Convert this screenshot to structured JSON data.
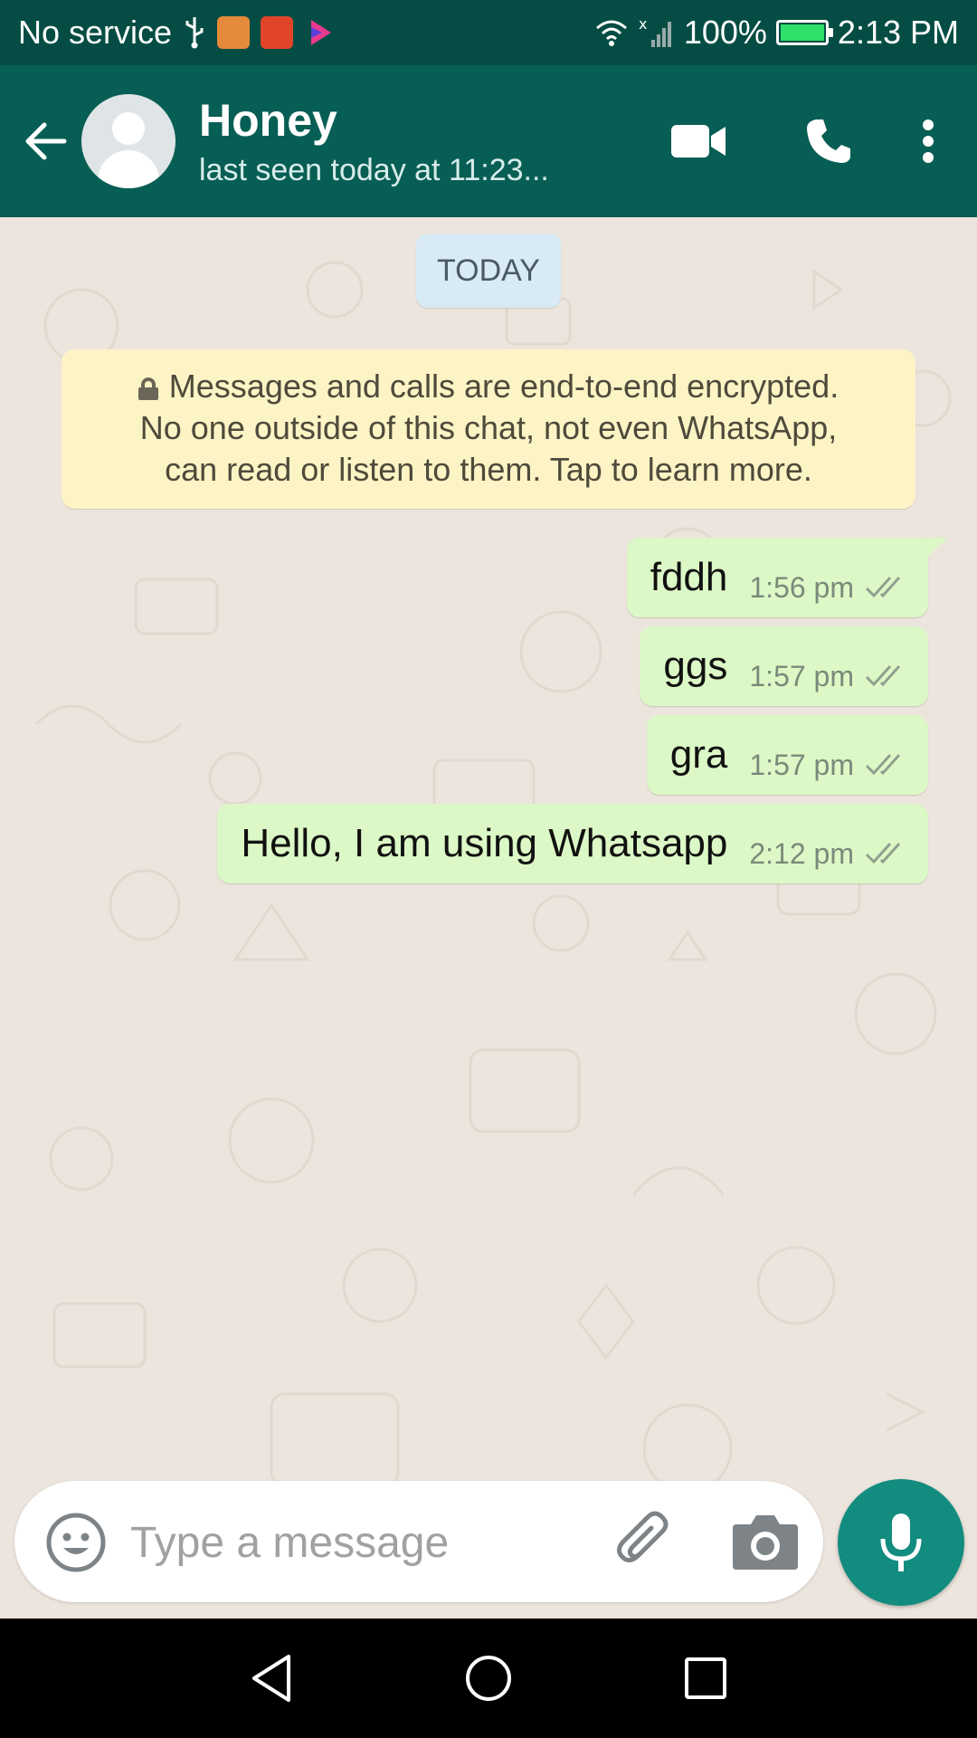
{
  "status_bar": {
    "carrier": "No service",
    "battery": "100%",
    "battery_level": 1.0,
    "time": "2:13 PM"
  },
  "header": {
    "contact_name": "Honey",
    "contact_status": "last seen today at 11:23...",
    "icons": [
      "back-arrow-icon",
      "avatar",
      "video-call-icon",
      "phone-icon",
      "more-options-icon"
    ]
  },
  "chat": {
    "date_label": "TODAY",
    "encryption_notice": {
      "line1": "Messages and calls are end-to-end encrypted.",
      "line2": "No one outside of this chat, not even WhatsApp,",
      "line3": "can read or listen to them. Tap to learn more."
    },
    "messages": [
      {
        "text": "fddh",
        "time": "1:56 pm",
        "status": "read"
      },
      {
        "text": "ggs",
        "time": "1:57 pm",
        "status": "read"
      },
      {
        "text": "gra",
        "time": "1:57 pm",
        "status": "read"
      },
      {
        "text": "Hello, I am using Whatsapp",
        "time": "2:12 pm",
        "status": "read"
      }
    ]
  },
  "composer": {
    "placeholder": "Type a message",
    "value": ""
  },
  "colors": {
    "header": "#075e54",
    "status_bar": "#054d44",
    "outgoing_bubble": "#dcf8c6",
    "notice": "#fdf4c5",
    "chat_bg": "#ece5dd",
    "fab": "#128c7e",
    "read_ticks": "#8fa08e"
  }
}
